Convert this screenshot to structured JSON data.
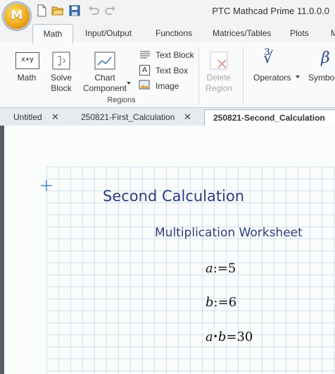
{
  "app": {
    "title": "PTC Mathcad Prime 11.0.0.0",
    "logo_letter": "M"
  },
  "ribbon_tabs": [
    "Math",
    "Input/Output",
    "Functions",
    "Matrices/Tables",
    "Plots",
    "M"
  ],
  "ribbon": {
    "math_label": "Math",
    "solve_block_line1": "Solve",
    "solve_block_line2": "Block",
    "chart_component_line1": "Chart",
    "chart_component_line2": "Component",
    "text_block": "Text Block",
    "text_box": "Text Box",
    "image": "Image",
    "delete_region_line1": "Delete",
    "delete_region_line2": "Region",
    "group_regions": "Regions",
    "operators": "Operators",
    "symbols": "Symbols",
    "operators_glyph": "∛",
    "symbols_glyph": "β",
    "math_icon_text": "x+y"
  },
  "document_tabs": [
    {
      "label": "Untitled",
      "close": "✕",
      "active": false
    },
    {
      "label": "250821-First_Calculation",
      "close": "✕",
      "active": false
    },
    {
      "label": "250821-Second_Calculation",
      "close": "✕",
      "active": true
    }
  ],
  "worksheet": {
    "title": "Second Calculation",
    "subtitle": "Multiplication Worksheet",
    "expr1": {
      "var": "a",
      "op": ":=",
      "value": "5"
    },
    "expr2": {
      "var": "b",
      "op": ":=",
      "value": "6"
    },
    "expr3": {
      "left": "a",
      "dot": "•",
      "right": "b",
      "eq": "=",
      "result": "30"
    }
  },
  "colors": {
    "accent_title": "#2c3a7c",
    "grid_line": "#cfe0ef",
    "ribbon_bg": "#f9fafb"
  }
}
